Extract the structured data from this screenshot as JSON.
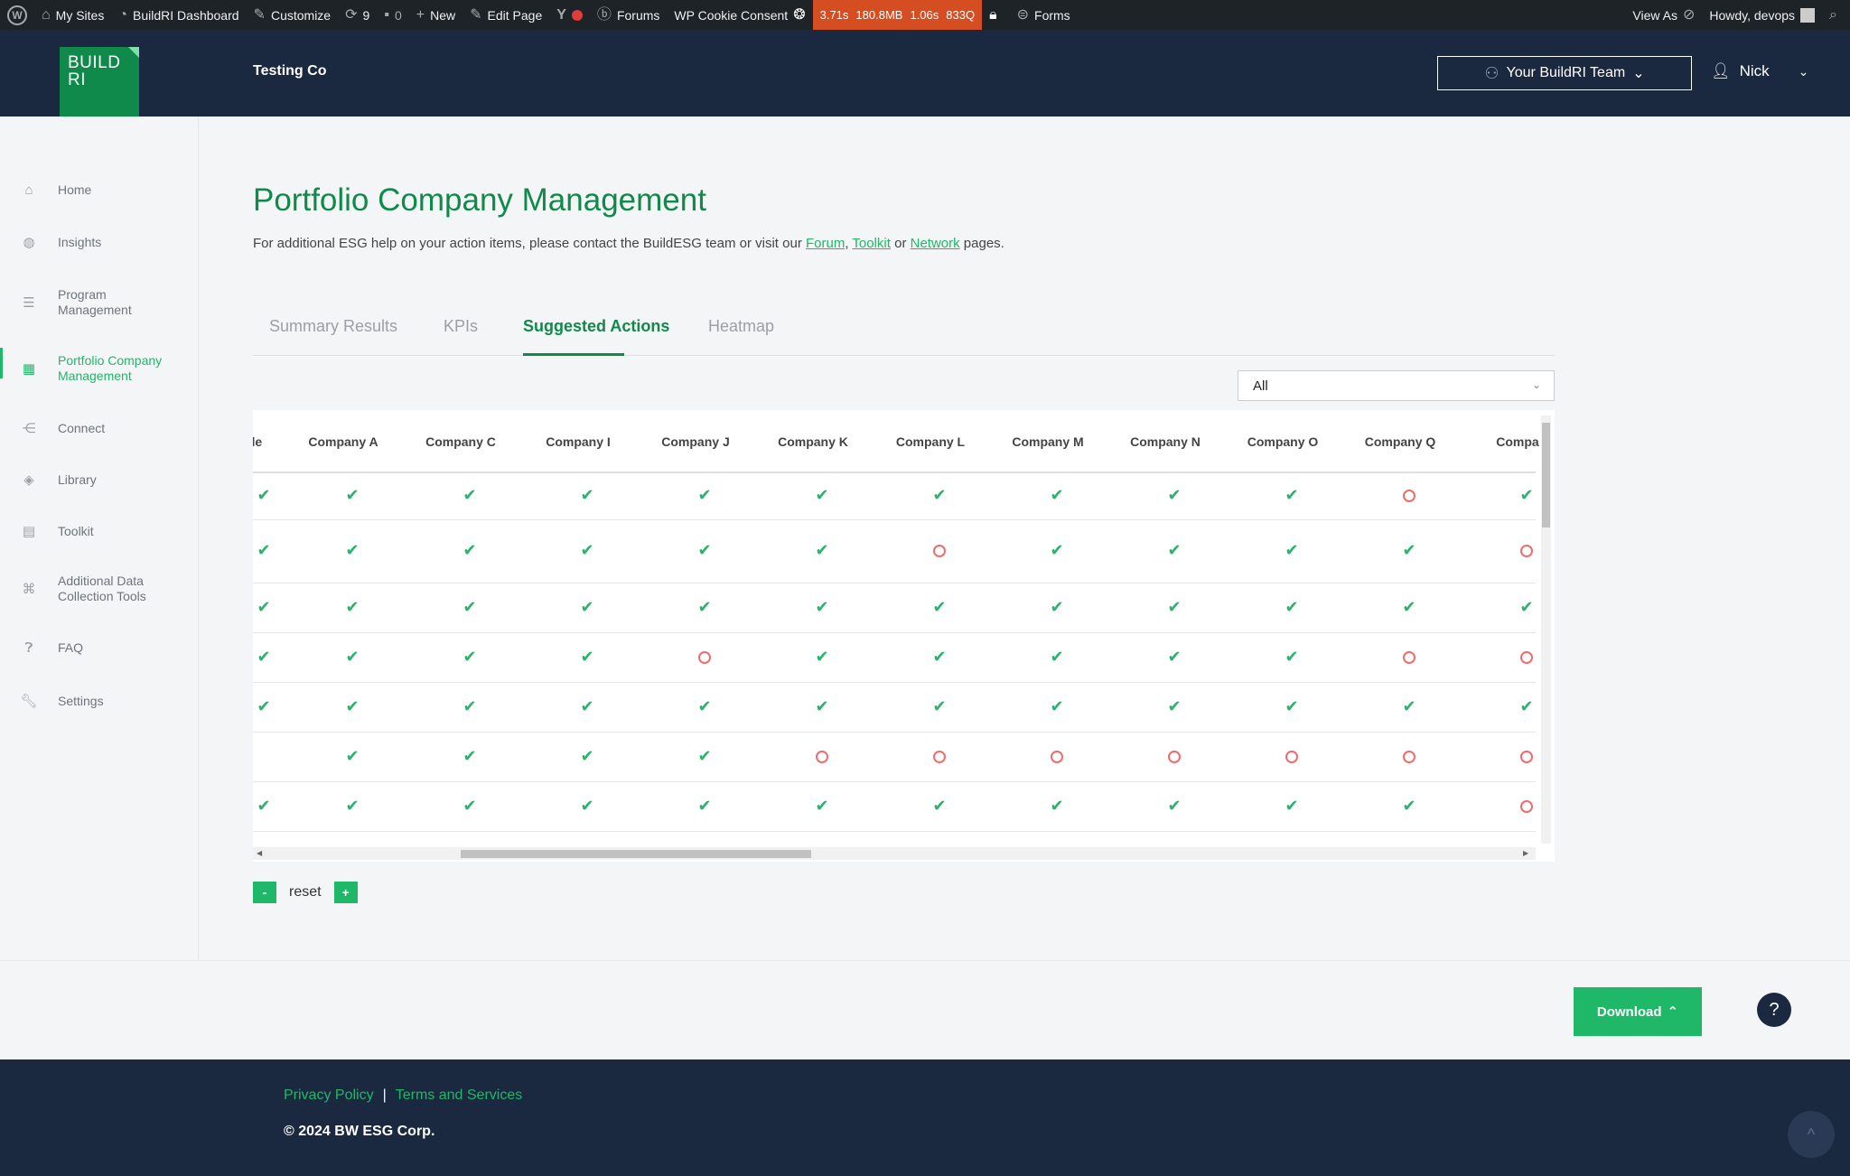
{
  "adminbar": {
    "my_sites": "My Sites",
    "dashboard": "BuildRI Dashboard",
    "customize": "Customize",
    "updates_count": "9",
    "comments_count": "0",
    "new": "New",
    "edit_page": "Edit Page",
    "forums": "Forums",
    "cookie": "WP Cookie Consent",
    "perf_time": "3.71s",
    "perf_mem": "180.8MB",
    "perf_query_time": "1.06s",
    "perf_queries": "833Q",
    "forms": "Forms",
    "view_as": "View As",
    "howdy": "Howdy, devops"
  },
  "header": {
    "logo_line1": "BUILD",
    "logo_line2": "RI",
    "company": "Testing Co",
    "team_button": "Your BuildRI Team",
    "user_name": "Nick"
  },
  "sidebar": {
    "items": [
      {
        "label": "Home",
        "icon": "home-icon"
      },
      {
        "label": "Insights",
        "icon": "globe-icon"
      },
      {
        "label": "Program Management",
        "icon": "bars-icon"
      },
      {
        "label": "Portfolio Company Management",
        "icon": "grid-icon"
      },
      {
        "label": "Connect",
        "icon": "share-icon"
      },
      {
        "label": "Library",
        "icon": "layers-icon"
      },
      {
        "label": "Toolkit",
        "icon": "toolbox-icon"
      },
      {
        "label": "Additional Data Collection Tools",
        "icon": "command-icon"
      },
      {
        "label": "FAQ",
        "icon": "question-icon"
      },
      {
        "label": "Settings",
        "icon": "wrench-icon"
      }
    ],
    "active_index": 3
  },
  "main": {
    "title": "Portfolio Company Management",
    "subtitle_pre": "For additional ESG help on your action items, please contact the BuildESG team or visit our ",
    "link_forum": "Forum",
    "comma": ",",
    "link_toolkit": "Toolkit",
    "or": " or ",
    "link_network": "Network",
    "subtitle_post": " pages.",
    "tabs": [
      {
        "label": "Summary Results"
      },
      {
        "label": "KPIs"
      },
      {
        "label": "Suggested Actions"
      },
      {
        "label": "Heatmap"
      }
    ],
    "active_tab": 2,
    "filter_value": "All"
  },
  "table": {
    "columns": [
      "de",
      "Company A",
      "Company C",
      "Company I",
      "Company J",
      "Company K",
      "Company L",
      "Company M",
      "Company N",
      "Company O",
      "Company Q",
      "Compa"
    ],
    "rows": [
      [
        "check",
        "check",
        "check",
        "check",
        "check",
        "check",
        "check",
        "check",
        "check",
        "check",
        "circle",
        "check"
      ],
      [
        "check",
        "check",
        "check",
        "check",
        "check",
        "check",
        "circle",
        "check",
        "check",
        "check",
        "check",
        "circle"
      ],
      [
        "check",
        "check",
        "check",
        "check",
        "check",
        "check",
        "check",
        "check",
        "check",
        "check",
        "check",
        "check"
      ],
      [
        "check",
        "check",
        "check",
        "check",
        "circle",
        "check",
        "check",
        "check",
        "check",
        "check",
        "circle",
        "circle"
      ],
      [
        "check",
        "check",
        "check",
        "check",
        "check",
        "check",
        "check",
        "check",
        "check",
        "check",
        "check",
        "check"
      ],
      [
        "",
        "check",
        "check",
        "check",
        "check",
        "circle",
        "circle",
        "circle",
        "circle",
        "circle",
        "circle",
        "circle"
      ],
      [
        "check",
        "check",
        "check",
        "check",
        "check",
        "check",
        "check",
        "check",
        "check",
        "check",
        "check",
        "circle"
      ]
    ],
    "colors": {
      "check": "#2ab36b",
      "circle": "#f06b6b"
    }
  },
  "zoom": {
    "minus": "-",
    "reset": "reset",
    "plus": "+"
  },
  "actions": {
    "download": "Download",
    "help": "?"
  },
  "footer": {
    "privacy": "Privacy Policy",
    "sep": "|",
    "terms": "Terms and Services",
    "copyright": "© 2024 BW ESG Corp."
  },
  "colors": {
    "brand_green": "#0f8a4a",
    "accent_green": "#1fb868",
    "navy": "#1a2840"
  }
}
